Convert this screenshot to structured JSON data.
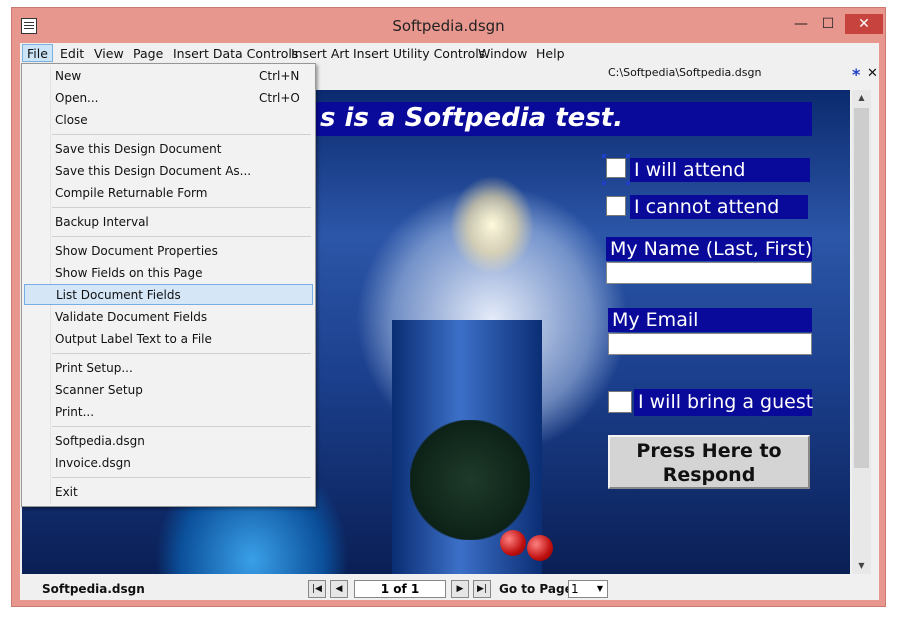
{
  "window": {
    "title": "Softpedia.dsgn"
  },
  "menubar": [
    "File",
    "Edit",
    "View",
    "Page",
    "Insert Data Controls",
    "Insert Art",
    "Insert Utility Controls",
    "Window",
    "Help"
  ],
  "doc": {
    "path": "C:\\Softpedia\\Softpedia.dsgn",
    "star": "*",
    "close": "✕"
  },
  "file_menu": {
    "items": [
      {
        "label": "New",
        "shortcut": "Ctrl+N"
      },
      {
        "label": "Open...",
        "shortcut": "Ctrl+O"
      },
      {
        "label": "Close",
        "shortcut": ""
      },
      {
        "label": "Save this Design Document",
        "shortcut": ""
      },
      {
        "label": "Save this Design Document As...",
        "shortcut": ""
      },
      {
        "label": "Compile Returnable Form",
        "shortcut": ""
      },
      {
        "label": "Backup Interval",
        "shortcut": ""
      },
      {
        "label": "Show Document Properties",
        "shortcut": ""
      },
      {
        "label": "Show Fields on this Page",
        "shortcut": ""
      },
      {
        "label": "List Document Fields",
        "shortcut": ""
      },
      {
        "label": "Validate Document Fields",
        "shortcut": ""
      },
      {
        "label": "Output Label Text to a File",
        "shortcut": ""
      },
      {
        "label": "Print Setup...",
        "shortcut": ""
      },
      {
        "label": "Scanner Setup",
        "shortcut": ""
      },
      {
        "label": "Print...",
        "shortcut": ""
      },
      {
        "label": "Softpedia.dsgn",
        "shortcut": ""
      },
      {
        "label": "Invoice.dsgn",
        "shortcut": ""
      },
      {
        "label": "Exit",
        "shortcut": ""
      }
    ],
    "highlighted": "List Document Fields"
  },
  "form": {
    "banner": "s is a Softpedia test.",
    "attend": "I will attend",
    "not_attend": "I cannot attend",
    "name_label": "My Name (Last, First)",
    "email_label": "My Email",
    "guest": "I will bring a guest",
    "respond_line1": "Press Here to",
    "respond_line2": "Respond"
  },
  "status": {
    "file": "Softpedia.dsgn",
    "page": "1 of 1",
    "goto_label": "Go to Page",
    "goto_value": "1"
  },
  "colors": {
    "accent_blue": "#0a0a9a",
    "highlight": "#d5e6f7",
    "title_bar": "#e8978f"
  }
}
